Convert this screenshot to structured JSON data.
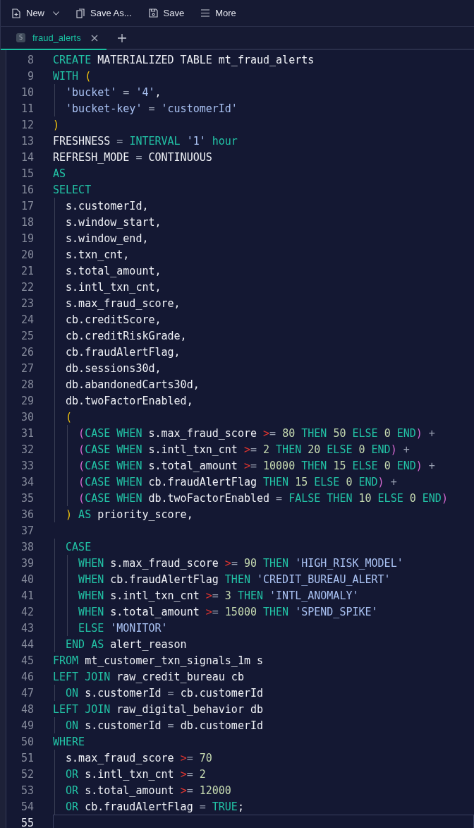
{
  "toolbar": [
    {
      "label": "New",
      "kind": "new",
      "dropdown": true
    },
    {
      "label": "Save As...",
      "kind": "saveas",
      "dropdown": false
    },
    {
      "label": "Save",
      "kind": "save",
      "dropdown": false
    },
    {
      "label": "More",
      "kind": "more",
      "dropdown": false
    }
  ],
  "tabs": [
    {
      "label": "fraud_alerts",
      "badge": "S",
      "selected": true
    }
  ],
  "editor": {
    "lines": [
      {
        "number": "8",
        "current": false,
        "tokens": [
          {
            "kind": "kw",
            "text": "CREATE "
          },
          {
            "kind": "id",
            "text": "MATERIALIZED TABLE mt_fraud_alerts"
          }
        ]
      },
      {
        "number": "9",
        "current": false,
        "tokens": [
          {
            "kind": "kw",
            "text": "WITH "
          },
          {
            "kind": "p1",
            "text": "("
          }
        ]
      },
      {
        "number": "10",
        "current": false,
        "tokens": [
          {
            "kind": "str",
            "text": "  'bucket'"
          },
          {
            "kind": "op",
            "text": " = "
          },
          {
            "kind": "str",
            "text": "'4'"
          },
          {
            "kind": "id",
            "text": ","
          }
        ]
      },
      {
        "number": "11",
        "current": false,
        "tokens": [
          {
            "kind": "str",
            "text": "  'bucket-key'"
          },
          {
            "kind": "op",
            "text": " = "
          },
          {
            "kind": "str",
            "text": "'customerId'"
          }
        ]
      },
      {
        "number": "12",
        "current": false,
        "tokens": [
          {
            "kind": "p1",
            "text": ")"
          }
        ]
      },
      {
        "number": "13",
        "current": false,
        "tokens": [
          {
            "kind": "id",
            "text": "FRESHNESS "
          },
          {
            "kind": "op",
            "text": "= "
          },
          {
            "kind": "kw",
            "text": "INTERVAL "
          },
          {
            "kind": "str",
            "text": "'1'"
          },
          {
            "kind": "kw",
            "text": " hour"
          }
        ]
      },
      {
        "number": "14",
        "current": false,
        "tokens": [
          {
            "kind": "id",
            "text": "REFRESH_MODE "
          },
          {
            "kind": "op",
            "text": "= "
          },
          {
            "kind": "id",
            "text": "CONTINUOUS"
          }
        ]
      },
      {
        "number": "15",
        "current": false,
        "tokens": [
          {
            "kind": "kw",
            "text": "AS"
          }
        ]
      },
      {
        "number": "16",
        "current": false,
        "tokens": [
          {
            "kind": "kw",
            "text": "SELECT"
          }
        ]
      },
      {
        "number": "17",
        "current": false,
        "tokens": [
          {
            "kind": "id",
            "text": "  s.customerId,"
          }
        ]
      },
      {
        "number": "18",
        "current": false,
        "tokens": [
          {
            "kind": "id",
            "text": "  s.window_start,"
          }
        ]
      },
      {
        "number": "19",
        "current": false,
        "tokens": [
          {
            "kind": "id",
            "text": "  s.window_end,"
          }
        ]
      },
      {
        "number": "20",
        "current": false,
        "tokens": [
          {
            "kind": "id",
            "text": "  s.txn_cnt,"
          }
        ]
      },
      {
        "number": "21",
        "current": false,
        "tokens": [
          {
            "kind": "id",
            "text": "  s.total_amount,"
          }
        ]
      },
      {
        "number": "22",
        "current": false,
        "tokens": [
          {
            "kind": "id",
            "text": "  s.intl_txn_cnt,"
          }
        ]
      },
      {
        "number": "23",
        "current": false,
        "tokens": [
          {
            "kind": "id",
            "text": "  s.max_fraud_score,"
          }
        ]
      },
      {
        "number": "24",
        "current": false,
        "tokens": [
          {
            "kind": "id",
            "text": "  cb.creditScore,"
          }
        ]
      },
      {
        "number": "25",
        "current": false,
        "tokens": [
          {
            "kind": "id",
            "text": "  cb.creditRiskGrade,"
          }
        ]
      },
      {
        "number": "26",
        "current": false,
        "tokens": [
          {
            "kind": "id",
            "text": "  cb.fraudAlertFlag,"
          }
        ]
      },
      {
        "number": "27",
        "current": false,
        "tokens": [
          {
            "kind": "id",
            "text": "  db.sessions30d,"
          }
        ]
      },
      {
        "number": "28",
        "current": false,
        "tokens": [
          {
            "kind": "id",
            "text": "  db.abandonedCarts30d,"
          }
        ]
      },
      {
        "number": "29",
        "current": false,
        "tokens": [
          {
            "kind": "id",
            "text": "  db.twoFactorEnabled,"
          }
        ]
      },
      {
        "number": "30",
        "current": false,
        "tokens": [
          {
            "kind": "p1",
            "text": "  ("
          }
        ]
      },
      {
        "number": "31",
        "current": false,
        "tokens": [
          {
            "kind": "p2",
            "text": "    ("
          },
          {
            "kind": "kw",
            "text": "CASE WHEN"
          },
          {
            "kind": "id",
            "text": " s.max_fraud_score "
          },
          {
            "kind": "cmp",
            "text": ">"
          },
          {
            "kind": "op",
            "text": "= "
          },
          {
            "kind": "num",
            "text": "80"
          },
          {
            "kind": "kw",
            "text": " THEN "
          },
          {
            "kind": "num",
            "text": "50"
          },
          {
            "kind": "kw",
            "text": " ELSE "
          },
          {
            "kind": "num",
            "text": "0"
          },
          {
            "kind": "kw",
            "text": " END"
          },
          {
            "kind": "p2",
            "text": ")"
          },
          {
            "kind": "op",
            "text": " +"
          }
        ]
      },
      {
        "number": "32",
        "current": false,
        "tokens": [
          {
            "kind": "p2",
            "text": "    ("
          },
          {
            "kind": "kw",
            "text": "CASE WHEN"
          },
          {
            "kind": "id",
            "text": " s.intl_txn_cnt "
          },
          {
            "kind": "cmp",
            "text": ">"
          },
          {
            "kind": "op",
            "text": "= "
          },
          {
            "kind": "num",
            "text": "2"
          },
          {
            "kind": "kw",
            "text": " THEN "
          },
          {
            "kind": "num",
            "text": "20"
          },
          {
            "kind": "kw",
            "text": " ELSE "
          },
          {
            "kind": "num",
            "text": "0"
          },
          {
            "kind": "kw",
            "text": " END"
          },
          {
            "kind": "p2",
            "text": ")"
          },
          {
            "kind": "op",
            "text": " +"
          }
        ]
      },
      {
        "number": "33",
        "current": false,
        "tokens": [
          {
            "kind": "p2",
            "text": "    ("
          },
          {
            "kind": "kw",
            "text": "CASE WHEN"
          },
          {
            "kind": "id",
            "text": " s.total_amount "
          },
          {
            "kind": "cmp",
            "text": ">"
          },
          {
            "kind": "op",
            "text": "= "
          },
          {
            "kind": "num",
            "text": "10000"
          },
          {
            "kind": "kw",
            "text": " THEN "
          },
          {
            "kind": "num",
            "text": "15"
          },
          {
            "kind": "kw",
            "text": " ELSE "
          },
          {
            "kind": "num",
            "text": "0"
          },
          {
            "kind": "kw",
            "text": " END"
          },
          {
            "kind": "p2",
            "text": ")"
          },
          {
            "kind": "op",
            "text": " +"
          }
        ]
      },
      {
        "number": "34",
        "current": false,
        "tokens": [
          {
            "kind": "p2",
            "text": "    ("
          },
          {
            "kind": "kw",
            "text": "CASE WHEN"
          },
          {
            "kind": "id",
            "text": " cb.fraudAlertFlag"
          },
          {
            "kind": "kw",
            "text": " THEN "
          },
          {
            "kind": "num",
            "text": "15"
          },
          {
            "kind": "kw",
            "text": " ELSE "
          },
          {
            "kind": "num",
            "text": "0"
          },
          {
            "kind": "kw",
            "text": " END"
          },
          {
            "kind": "p2",
            "text": ")"
          },
          {
            "kind": "op",
            "text": " +"
          }
        ]
      },
      {
        "number": "35",
        "current": false,
        "tokens": [
          {
            "kind": "p2",
            "text": "    ("
          },
          {
            "kind": "kw",
            "text": "CASE WHEN"
          },
          {
            "kind": "id",
            "text": " db.twoFactorEnabled "
          },
          {
            "kind": "op",
            "text": "= "
          },
          {
            "kind": "kw",
            "text": "FALSE THEN "
          },
          {
            "kind": "num",
            "text": "10"
          },
          {
            "kind": "kw",
            "text": " ELSE "
          },
          {
            "kind": "num",
            "text": "0"
          },
          {
            "kind": "kw",
            "text": " END"
          },
          {
            "kind": "p2",
            "text": ")"
          }
        ]
      },
      {
        "number": "36",
        "current": false,
        "tokens": [
          {
            "kind": "p1",
            "text": "  )"
          },
          {
            "kind": "kw",
            "text": " AS"
          },
          {
            "kind": "id",
            "text": " priority_score,"
          }
        ]
      },
      {
        "number": "37",
        "current": false
      },
      {
        "number": "38",
        "current": false,
        "tokens": [
          {
            "kind": "kw",
            "text": "  CASE"
          }
        ]
      },
      {
        "number": "39",
        "current": false,
        "tokens": [
          {
            "kind": "kw",
            "text": "    WHEN"
          },
          {
            "kind": "id",
            "text": " s.max_fraud_score "
          },
          {
            "kind": "cmp",
            "text": ">"
          },
          {
            "kind": "op",
            "text": "= "
          },
          {
            "kind": "num",
            "text": "90"
          },
          {
            "kind": "kw",
            "text": " THEN "
          },
          {
            "kind": "str",
            "text": "'HIGH_RISK_MODEL'"
          }
        ]
      },
      {
        "number": "40",
        "current": false,
        "tokens": [
          {
            "kind": "kw",
            "text": "    WHEN"
          },
          {
            "kind": "id",
            "text": " cb.fraudAlertFlag"
          },
          {
            "kind": "kw",
            "text": " THEN "
          },
          {
            "kind": "str",
            "text": "'CREDIT_BUREAU_ALERT'"
          }
        ]
      },
      {
        "number": "41",
        "current": false,
        "tokens": [
          {
            "kind": "kw",
            "text": "    WHEN"
          },
          {
            "kind": "id",
            "text": " s.intl_txn_cnt "
          },
          {
            "kind": "cmp",
            "text": ">"
          },
          {
            "kind": "op",
            "text": "= "
          },
          {
            "kind": "num",
            "text": "3"
          },
          {
            "kind": "kw",
            "text": " THEN "
          },
          {
            "kind": "str",
            "text": "'INTL_ANOMALY'"
          }
        ]
      },
      {
        "number": "42",
        "current": false,
        "tokens": [
          {
            "kind": "kw",
            "text": "    WHEN"
          },
          {
            "kind": "id",
            "text": " s.total_amount "
          },
          {
            "kind": "cmp",
            "text": ">"
          },
          {
            "kind": "op",
            "text": "= "
          },
          {
            "kind": "num",
            "text": "15000"
          },
          {
            "kind": "kw",
            "text": " THEN "
          },
          {
            "kind": "str",
            "text": "'SPEND_SPIKE'"
          }
        ]
      },
      {
        "number": "43",
        "current": false,
        "tokens": [
          {
            "kind": "kw",
            "text": "    ELSE "
          },
          {
            "kind": "str",
            "text": "'MONITOR'"
          }
        ]
      },
      {
        "number": "44",
        "current": false,
        "tokens": [
          {
            "kind": "kw",
            "text": "  END AS"
          },
          {
            "kind": "id",
            "text": " alert_reason"
          }
        ]
      },
      {
        "number": "45",
        "current": false,
        "tokens": [
          {
            "kind": "kw",
            "text": "FROM"
          },
          {
            "kind": "id",
            "text": " mt_customer_txn_signals_1m s"
          }
        ]
      },
      {
        "number": "46",
        "current": false,
        "tokens": [
          {
            "kind": "kw",
            "text": "LEFT JOIN"
          },
          {
            "kind": "id",
            "text": " raw_credit_bureau cb"
          }
        ]
      },
      {
        "number": "47",
        "current": false,
        "tokens": [
          {
            "kind": "kw",
            "text": "  ON"
          },
          {
            "kind": "id",
            "text": " s.customerId "
          },
          {
            "kind": "op",
            "text": "= "
          },
          {
            "kind": "id",
            "text": "cb.customerId"
          }
        ]
      },
      {
        "number": "48",
        "current": false,
        "tokens": [
          {
            "kind": "kw",
            "text": "LEFT JOIN"
          },
          {
            "kind": "id",
            "text": " raw_digital_behavior db"
          }
        ]
      },
      {
        "number": "49",
        "current": false,
        "tokens": [
          {
            "kind": "kw",
            "text": "  ON"
          },
          {
            "kind": "id",
            "text": " s.customerId "
          },
          {
            "kind": "op",
            "text": "= "
          },
          {
            "kind": "id",
            "text": "db.customerId"
          }
        ]
      },
      {
        "number": "50",
        "current": false,
        "tokens": [
          {
            "kind": "kw",
            "text": "WHERE"
          }
        ]
      },
      {
        "number": "51",
        "current": false,
        "tokens": [
          {
            "kind": "id",
            "text": "  s.max_fraud_score "
          },
          {
            "kind": "cmp",
            "text": ">"
          },
          {
            "kind": "op",
            "text": "= "
          },
          {
            "kind": "num",
            "text": "70"
          }
        ]
      },
      {
        "number": "52",
        "current": false,
        "tokens": [
          {
            "kind": "kw",
            "text": "  OR"
          },
          {
            "kind": "id",
            "text": " s.intl_txn_cnt "
          },
          {
            "kind": "cmp",
            "text": ">"
          },
          {
            "kind": "op",
            "text": "= "
          },
          {
            "kind": "num",
            "text": "2"
          }
        ]
      },
      {
        "number": "53",
        "current": false,
        "tokens": [
          {
            "kind": "kw",
            "text": "  OR"
          },
          {
            "kind": "id",
            "text": " s.total_amount "
          },
          {
            "kind": "cmp",
            "text": ">"
          },
          {
            "kind": "op",
            "text": "= "
          },
          {
            "kind": "num",
            "text": "12000"
          }
        ]
      },
      {
        "number": "54",
        "current": false,
        "tokens": [
          {
            "kind": "kw",
            "text": "  OR"
          },
          {
            "kind": "id",
            "text": " cb.fraudAlertFlag "
          },
          {
            "kind": "op",
            "text": "= "
          },
          {
            "kind": "kw",
            "text": "TRUE"
          },
          {
            "kind": "id",
            "text": ";"
          }
        ]
      },
      {
        "number": "55",
        "current": true
      }
    ]
  }
}
